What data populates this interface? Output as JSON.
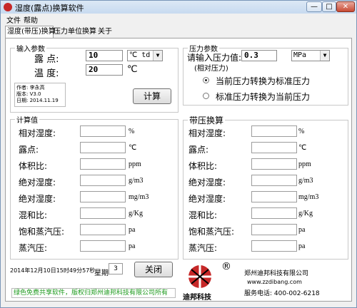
{
  "window": {
    "title": "湿度(露点)换算软件",
    "controls": {
      "minimize": "—",
      "maximize": "□",
      "close": "✕"
    }
  },
  "menu": {
    "items": [
      "文件",
      "帮助"
    ]
  },
  "tabs": [
    "湿度(带压)换算",
    "压力单位换算",
    "关于"
  ],
  "input_params": {
    "legend": "输入参数",
    "dewpoint_label": "露  点:",
    "dewpoint_value": "10",
    "dewpoint_unit": "℃ td",
    "temp_label": "温  度:",
    "temp_value": "20",
    "temp_unit": "℃"
  },
  "info": {
    "author": "作者: 李永高",
    "version": "版本: V3.0",
    "date": "日期: 2014.11.19"
  },
  "calc_button": "计算",
  "pressure": {
    "legend": "压力参数",
    "label": "请输入压力值:",
    "value": "0.3",
    "unit": "MPa",
    "note": "(相对压力)",
    "radio1": "当前压力转换为标准压力",
    "radio2": "标准压力转换为当前压力"
  },
  "calc_values": {
    "legend": "计算值",
    "rows": [
      {
        "label": "相对湿度:",
        "unit": "%"
      },
      {
        "label": "露点:",
        "unit": "℃"
      },
      {
        "label": "体积比:",
        "unit": "ppm"
      },
      {
        "label": "绝对湿度:",
        "unit": "g/m3"
      },
      {
        "label": "绝对湿度:",
        "unit": "mg/m3"
      },
      {
        "label": "混和比:",
        "unit": "g/Kg"
      },
      {
        "label": "饱和蒸汽压:",
        "unit": "pa"
      },
      {
        "label": "蒸汽压:",
        "unit": "pa"
      }
    ]
  },
  "pressure_conv": {
    "legend": "带压换算",
    "rows": [
      {
        "label": "相对湿度:",
        "unit": "%"
      },
      {
        "label": "露点:",
        "unit": "℃"
      },
      {
        "label": "体积比:",
        "unit": "ppm"
      },
      {
        "label": "绝对湿度:",
        "unit": "g/m3"
      },
      {
        "label": "绝对湿度:",
        "unit": "mg/m3"
      },
      {
        "label": "混和比:",
        "unit": "g/Kg"
      },
      {
        "label": "饱和蒸汽压:",
        "unit": "pa"
      },
      {
        "label": "蒸汽压:",
        "unit": "pa"
      }
    ]
  },
  "status": {
    "datetime": "2014年12月10日15时49分57秒",
    "weekday_label": "星期",
    "weekday_value": "3"
  },
  "close_button": "关闭",
  "company": {
    "logo_text": "迪邦科技",
    "registered": "®",
    "name": "郑州迪邦科技有限公司",
    "website": "www.zzdibang.com",
    "phone": "服务电话: 400-002-6218"
  },
  "footer": "绿色免费共享软件，版权归郑州迪邦科技有限公司所有",
  "colors": {
    "accent_red": "#c62828",
    "footer_green": "#1c9a1c"
  }
}
